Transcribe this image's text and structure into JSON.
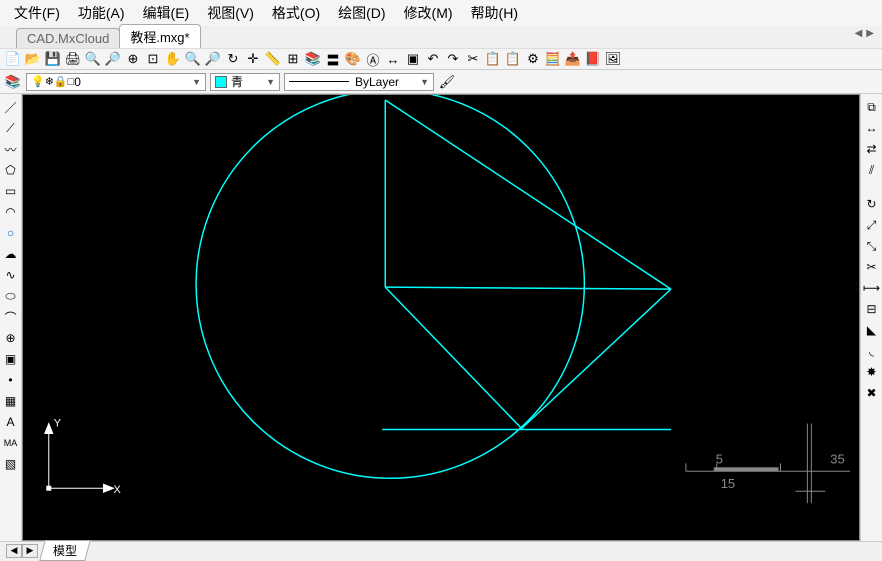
{
  "menu": {
    "file": "文件(F)",
    "func": "功能(A)",
    "edit": "编辑(E)",
    "view": "视图(V)",
    "format": "格式(O)",
    "draw": "绘图(D)",
    "modify": "修改(M)",
    "help": "帮助(H)"
  },
  "tabs": {
    "t1": "CAD.MxCloud",
    "t2": "教程.mxg*"
  },
  "layer": {
    "name": "0",
    "color_name": "青",
    "linetype": "ByLayer"
  },
  "bottom": {
    "model_tab": "模型"
  },
  "scale": {
    "n5": "5",
    "n15": "15",
    "n35": "35"
  },
  "axis": {
    "x": "X",
    "y": "Y"
  },
  "icons": {
    "new": "📄",
    "open": "📂",
    "save": "💾",
    "print": "🖨",
    "cut": "✂",
    "copy": "📋",
    "undo": "↶",
    "redo": "↷",
    "zoom_in": "🔍",
    "zoom_out": "🔎",
    "pan": "✋",
    "layers": "📚",
    "color": "🎨",
    "line": "／",
    "pline": "〰",
    "circle": "○",
    "arc": "◠",
    "rect": "▭",
    "point": "•",
    "text": "A",
    "mtext": "MA",
    "hatch": "▦",
    "move": "↔",
    "rotate": "↻",
    "scale": "⤢",
    "mirror": "⇄",
    "trim": "✂",
    "erase": "✖",
    "dim": "↔",
    "brush": "🖌"
  }
}
